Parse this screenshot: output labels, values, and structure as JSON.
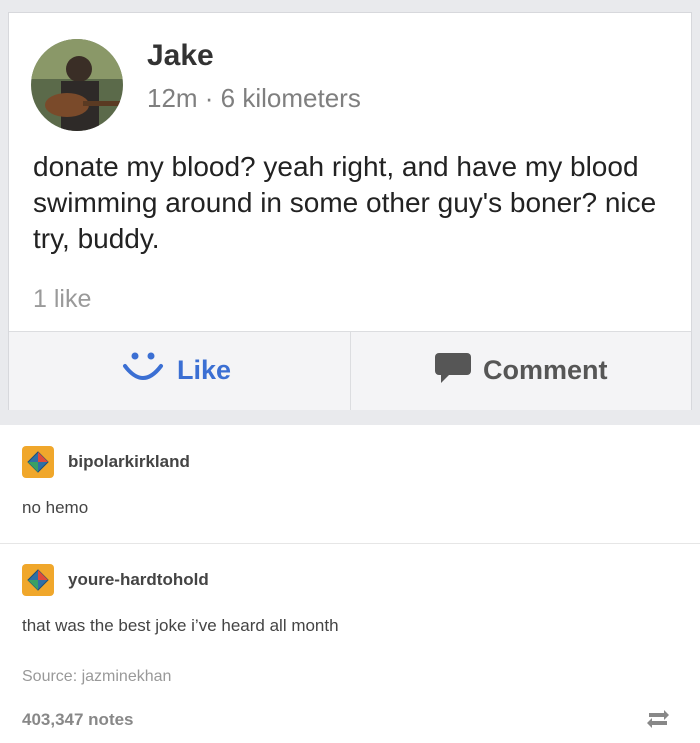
{
  "post": {
    "author": "Jake",
    "meta": "12m · 6 kilometers",
    "text": "donate my blood? yeah right, and have my blood swimming around in some other guy's boner? nice try, buddy.",
    "likes": "1 like",
    "actions": {
      "like_label": "Like",
      "comment_label": "Comment"
    }
  },
  "replies": [
    {
      "username": "bipolarkirkland",
      "text": "no hemo"
    },
    {
      "username": "youre-hardtohold",
      "text": "that was the best joke i’ve heard all month"
    }
  ],
  "source": "Source: jazminekhan",
  "notes": "403,347 notes",
  "colors": {
    "like_blue": "#3b6fd3",
    "avatar_orange": "#f0a72b",
    "gray_bg": "#e9eaed"
  },
  "icons": [
    "smile-icon",
    "comment-bubble-icon",
    "diamond-avatar-icon",
    "reblog-icon"
  ]
}
